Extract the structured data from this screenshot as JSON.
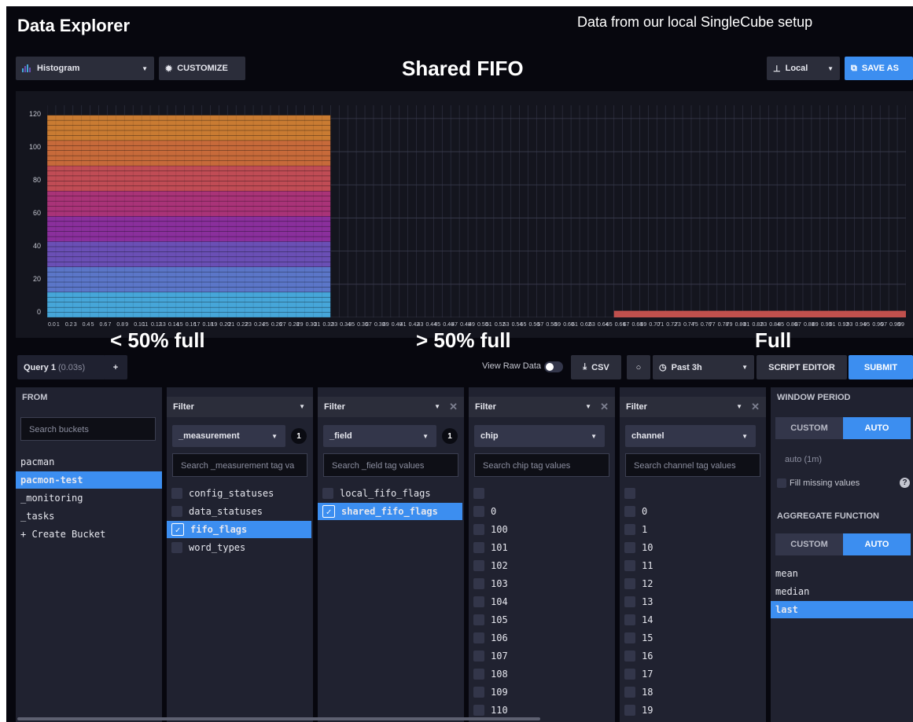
{
  "header": {
    "title": "Data Explorer",
    "note": "Data from our local SingleCube setup"
  },
  "toolbar": {
    "graph_type": "Histogram",
    "customize": "CUSTOMIZE",
    "chart_title": "Shared FIFO",
    "source": "Local",
    "save_as": "SAVE AS"
  },
  "annotations": {
    "left": "< 50% full",
    "middle": "> 50% full",
    "right": "Full"
  },
  "chart_data": {
    "type": "bar",
    "y_ticks": [
      "120",
      "100",
      "80",
      "60",
      "40",
      "20",
      "0"
    ],
    "ylim": [
      0,
      128
    ],
    "x_range": [
      0,
      100
    ],
    "series": [
      {
        "x_start": 0,
        "x_end": 33,
        "value": 122,
        "style": "stacked-colored"
      },
      {
        "x_start": 66,
        "x_end": 100,
        "value": 4,
        "color": "#c0504d"
      }
    ],
    "colors": [
      "#46a6d9",
      "#5b76c8",
      "#6a4fb5",
      "#8a2f9c",
      "#a93378",
      "#c04c55",
      "#c76a3a",
      "#c97b32"
    ]
  },
  "query_bar": {
    "tab": "Query 1",
    "tab_time": "(0.03s)",
    "add_tab": "+",
    "view_raw": "View Raw Data",
    "csv": "CSV",
    "time_range": "Past 3h",
    "script_editor": "SCRIPT EDITOR",
    "submit": "SUBMIT"
  },
  "from": {
    "header": "FROM",
    "search_placeholder": "Search buckets",
    "buckets": [
      "pacman",
      "pacmon-test",
      "_monitoring",
      "_tasks",
      "+ Create Bucket"
    ],
    "selected_index": 1
  },
  "filter1": {
    "header": "Filter",
    "key": "_measurement",
    "count": "1",
    "search_placeholder": "Search _measurement tag va",
    "values": [
      "config_statuses",
      "data_statuses",
      "fifo_flags",
      "word_types"
    ],
    "checked_index": 2
  },
  "filter2": {
    "header": "Filter",
    "key": "_field",
    "count": "1",
    "search_placeholder": "Search _field tag values",
    "values": [
      "local_fifo_flags",
      "shared_fifo_flags"
    ],
    "checked_index": 1
  },
  "filter3": {
    "header": "Filter",
    "key": "chip",
    "search_placeholder": "Search chip tag values",
    "values": [
      "",
      "0",
      "100",
      "101",
      "102",
      "103",
      "104",
      "105",
      "106",
      "107",
      "108",
      "109",
      "110"
    ]
  },
  "filter4": {
    "header": "Filter",
    "key": "channel",
    "search_placeholder": "Search channel tag values",
    "values": [
      "",
      "0",
      "1",
      "10",
      "11",
      "12",
      "13",
      "14",
      "15",
      "16",
      "17",
      "18",
      "19"
    ]
  },
  "window": {
    "header": "WINDOW PERIOD",
    "custom": "CUSTOM",
    "auto": "AUTO",
    "auto_value": "auto (1m)",
    "fill_missing": "Fill missing values",
    "help": "?",
    "agg_header": "AGGREGATE FUNCTION",
    "agg_custom": "CUSTOM",
    "agg_auto": "AUTO",
    "functions": [
      "mean",
      "median",
      "last"
    ],
    "selected_function_index": 2
  }
}
